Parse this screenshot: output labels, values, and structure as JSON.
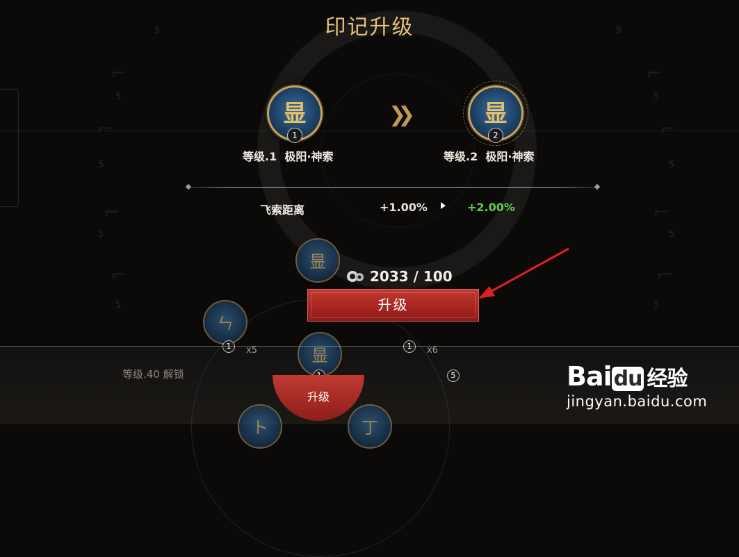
{
  "title": "印记升级",
  "current": {
    "glyph": "㫫",
    "level_badge": "1",
    "level_text": "等级.1",
    "name": "极阳·神索"
  },
  "next": {
    "glyph": "㫫",
    "level_badge": "2",
    "level_text": "等级.2",
    "name": "极阳·神索"
  },
  "stat": {
    "name": "飞索距离",
    "old_value": "+1.00%",
    "new_value": "+2.00%"
  },
  "cost": {
    "text": "2033 / 100",
    "icon": "currency-swirl-icon"
  },
  "upgrade_button": "升级",
  "background": {
    "unlock_text": "等级.40 解锁",
    "bottom_button": "升级",
    "small_levels": [
      "1",
      "1",
      "1",
      "5"
    ],
    "counts": [
      "x5",
      "x6"
    ],
    "faint_number": "5"
  },
  "watermark": {
    "logo_bai": "Bai",
    "logo_du": "du",
    "logo_cn": "经验",
    "url": "jingyan.baidu.com"
  },
  "colors": {
    "title": "#e7c27a",
    "stat_gain": "#5fd04a",
    "button": "#b12a24",
    "annotation_arrow": "#e02020"
  }
}
